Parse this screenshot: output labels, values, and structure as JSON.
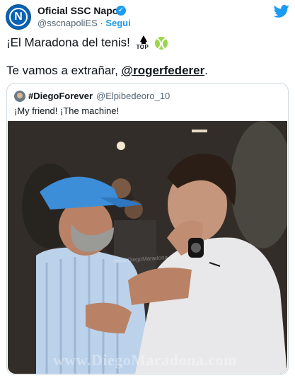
{
  "tweet": {
    "account_name": "Oficial SSC Napoli",
    "handle": "@sscnapoliES",
    "separator": "·",
    "follow_label": "Segui",
    "line1": "¡El Maradona del tenis!",
    "top_emoji_text": "TOP",
    "line2_prefix": "Te vamos a extrañar, ",
    "mention": "@rogerfederer",
    "line2_suffix": "."
  },
  "quoted": {
    "name": "#DiegoForever",
    "handle": "@Elpibedeoro_10",
    "text": "¡My friend! ¡The machine!",
    "photo_watermark": "www.DiegoMaradona.com",
    "photo_small_watermark": "www.DiegoMaradona.com"
  },
  "icons": {
    "twitter": "twitter-bird-icon",
    "verified": "verified-badge-icon",
    "top": "top-arrow-emoji",
    "tennis": "tennis-ball-emoji"
  },
  "colors": {
    "accent": "#1d9bf0",
    "text": "#0f1419",
    "muted": "#536471",
    "napoli_blue": "#0a62b4"
  }
}
